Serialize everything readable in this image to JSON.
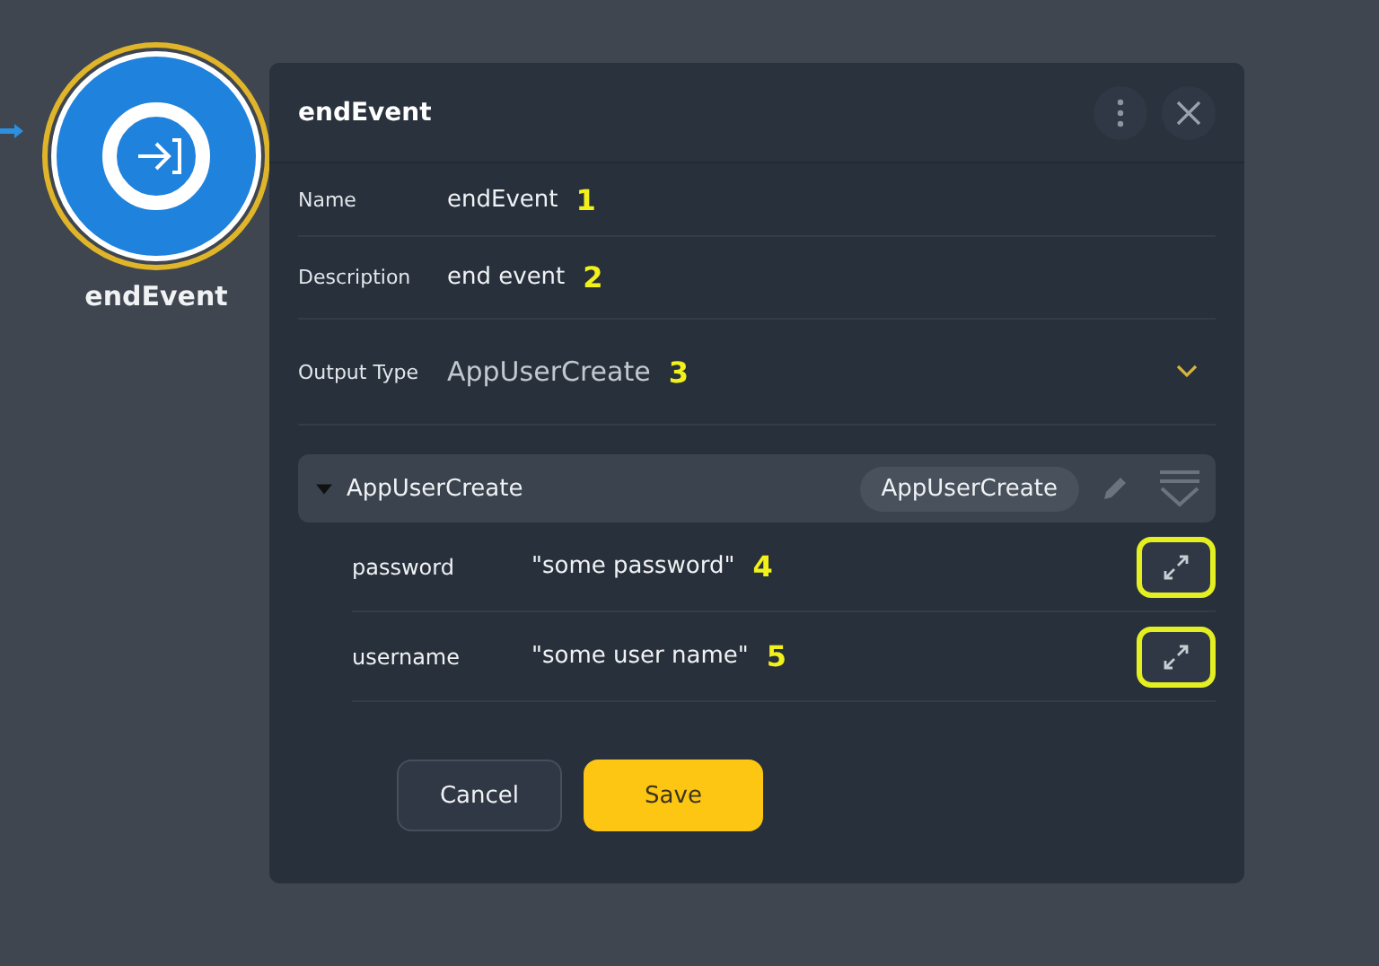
{
  "node": {
    "label": "endEvent",
    "selected": true
  },
  "panel": {
    "title": "endEvent",
    "fields": [
      {
        "label": "Name",
        "value": "endEvent",
        "callout": "1"
      },
      {
        "label": "Description",
        "value": "end event",
        "callout": "2"
      }
    ],
    "output_type": {
      "label": "Output Type",
      "value": "AppUserCreate",
      "callout": "3"
    },
    "group": {
      "name": "AppUserCreate",
      "expanded": true,
      "type_chip": "AppUserCreate",
      "properties": [
        {
          "name": "password",
          "value": "\"some password\"",
          "callout": "4",
          "highlighted": true
        },
        {
          "name": "username",
          "value": "\"some user name\"",
          "callout": "5",
          "highlighted": true
        }
      ]
    },
    "buttons": [
      {
        "label": "Cancel",
        "kind": "secondary"
      },
      {
        "label": "Save",
        "kind": "primary"
      }
    ]
  }
}
